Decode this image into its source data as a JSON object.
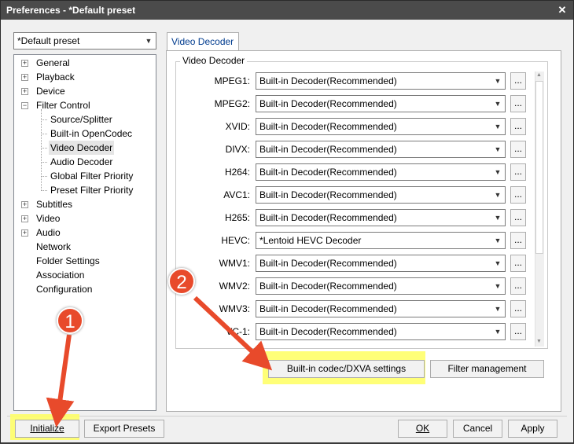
{
  "window": {
    "title": "Preferences - *Default preset",
    "close_label": "✕"
  },
  "preset_select": {
    "value": "*Default preset"
  },
  "tree": {
    "items": [
      {
        "label": "General",
        "expandable": true
      },
      {
        "label": "Playback",
        "expandable": true
      },
      {
        "label": "Device",
        "expandable": true
      },
      {
        "label": "Filter Control",
        "expandable": true,
        "expanded": true
      },
      {
        "label": "Source/Splitter",
        "child": true
      },
      {
        "label": "Built-in OpenCodec",
        "child": true
      },
      {
        "label": "Video Decoder",
        "child": true,
        "selected": true
      },
      {
        "label": "Audio Decoder",
        "child": true
      },
      {
        "label": "Global Filter Priority",
        "child": true
      },
      {
        "label": "Preset Filter Priority",
        "child": true
      },
      {
        "label": "Subtitles",
        "expandable": true
      },
      {
        "label": "Video",
        "expandable": true
      },
      {
        "label": "Audio",
        "expandable": true
      },
      {
        "label": "Network"
      },
      {
        "label": "Folder Settings"
      },
      {
        "label": "Association"
      },
      {
        "label": "Configuration"
      }
    ]
  },
  "tab": {
    "label": "Video Decoder"
  },
  "group": {
    "title": "Video Decoder"
  },
  "decoders": [
    {
      "label": "MPEG1:",
      "value": "Built-in Decoder(Recommended)"
    },
    {
      "label": "MPEG2:",
      "value": "Built-in Decoder(Recommended)"
    },
    {
      "label": "XVID:",
      "value": "Built-in Decoder(Recommended)"
    },
    {
      "label": "DIVX:",
      "value": "Built-in Decoder(Recommended)"
    },
    {
      "label": "H264:",
      "value": "Built-in Decoder(Recommended)"
    },
    {
      "label": "AVC1:",
      "value": "Built-in Decoder(Recommended)"
    },
    {
      "label": "H265:",
      "value": "Built-in Decoder(Recommended)"
    },
    {
      "label": "HEVC:",
      "value": "*Lentoid HEVC Decoder"
    },
    {
      "label": "WMV1:",
      "value": "Built-in Decoder(Recommended)"
    },
    {
      "label": "WMV2:",
      "value": "Built-in Decoder(Recommended)"
    },
    {
      "label": "WMV3:",
      "value": "Built-in Decoder(Recommended)"
    },
    {
      "label": "VC-1:",
      "value": "Built-in Decoder(Recommended)"
    }
  ],
  "dots_label": "...",
  "buttons": {
    "codec_settings": "Built-in codec/DXVA settings",
    "filter_management": "Filter management",
    "initialize": "Initialize",
    "export_presets": "Export Presets",
    "ok": "OK",
    "cancel": "Cancel",
    "apply": "Apply"
  },
  "annotations": {
    "callout_1": "1",
    "callout_2": "2",
    "highlight_color": "#ffff60",
    "arrow_color": "#e84a2b"
  }
}
